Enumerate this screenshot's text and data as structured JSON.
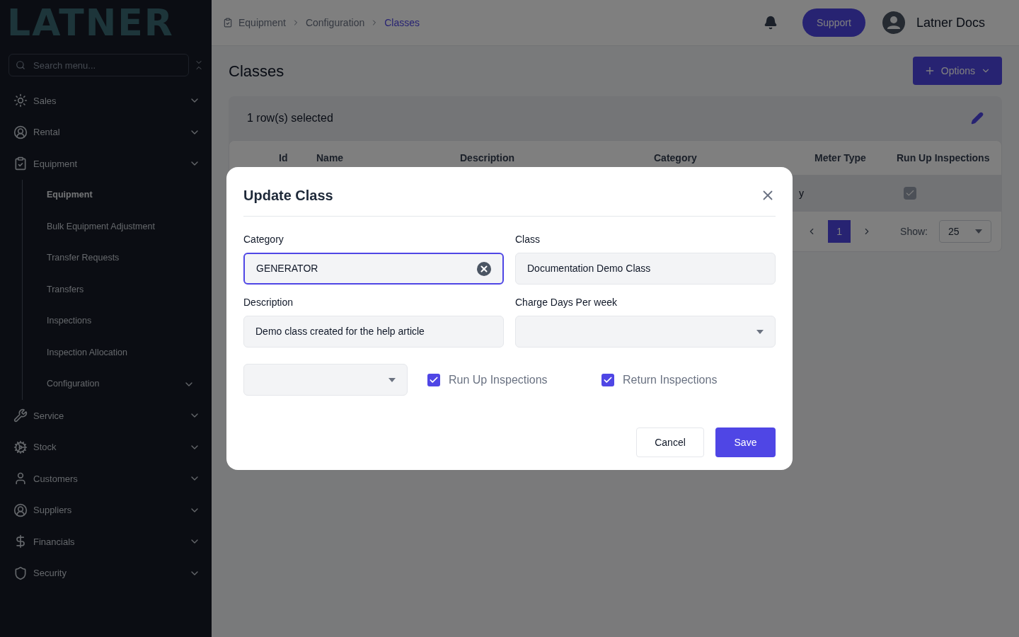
{
  "sidebar": {
    "logo": "LATNER",
    "search": {
      "placeholder": "Search menu..."
    },
    "items": [
      {
        "label": "Sales"
      },
      {
        "label": "Rental"
      },
      {
        "label": "Equipment",
        "children": [
          {
            "label": "Equipment",
            "selected": true,
            "kind": "link"
          },
          {
            "label": "Bulk Equipment Adjustment",
            "selected": false,
            "kind": "link"
          },
          {
            "label": "Transfer Requests",
            "selected": false,
            "kind": "link"
          },
          {
            "label": "Transfers",
            "selected": false,
            "kind": "link"
          },
          {
            "label": "Inspections",
            "selected": false,
            "kind": "link"
          },
          {
            "label": "Inspection Allocation",
            "selected": false,
            "kind": "link"
          },
          {
            "label": "Configuration",
            "selected": false,
            "kind": "group"
          }
        ]
      },
      {
        "label": "Service"
      },
      {
        "label": "Stock"
      },
      {
        "label": "Customers"
      },
      {
        "label": "Suppliers"
      },
      {
        "label": "Financials"
      },
      {
        "label": "Security"
      }
    ]
  },
  "header": {
    "breadcrumb": [
      {
        "label": "Equipment",
        "selected": false
      },
      {
        "label": "Configuration",
        "selected": false
      },
      {
        "label": "Classes",
        "selected": true
      }
    ],
    "support": "Support",
    "user": "Latner Docs"
  },
  "page": {
    "title": "Classes",
    "options": "Options",
    "selection": "1 row(s) selected",
    "table": {
      "columns": [
        "Id",
        "Name",
        "Description",
        "Category",
        "Meter Type",
        "Run Up Inspections"
      ],
      "rows": [
        {
          "selected": true,
          "category": "y",
          "run_up_inspections": true
        }
      ]
    },
    "pagination": {
      "pages": [
        {
          "label": "1",
          "selected": true
        }
      ],
      "show_label": "Show:",
      "page_size": "25"
    }
  },
  "dialog": {
    "title": "Update Class",
    "fields": [
      {
        "kind": "text",
        "label": "Category",
        "value": "GENERATOR",
        "focused": true,
        "clearable": true
      },
      {
        "kind": "text",
        "label": "Class",
        "value": "Documentation Demo Class",
        "focused": false,
        "clearable": false
      },
      {
        "kind": "text",
        "label": "Description",
        "value": "Demo class created for the help article",
        "focused": false,
        "clearable": false
      },
      {
        "kind": "select",
        "label": "Charge Days Per week",
        "focused": false
      }
    ],
    "options_row": [
      {
        "kind": "select"
      },
      {
        "kind": "checkbox",
        "label": "Run Up Inspections",
        "checked": true
      },
      {
        "kind": "checkbox",
        "label": "Return Inspections",
        "checked": true
      }
    ],
    "buttons": [
      {
        "label": "Cancel",
        "kind": "secondary"
      },
      {
        "label": "Save",
        "kind": "primary"
      }
    ]
  }
}
